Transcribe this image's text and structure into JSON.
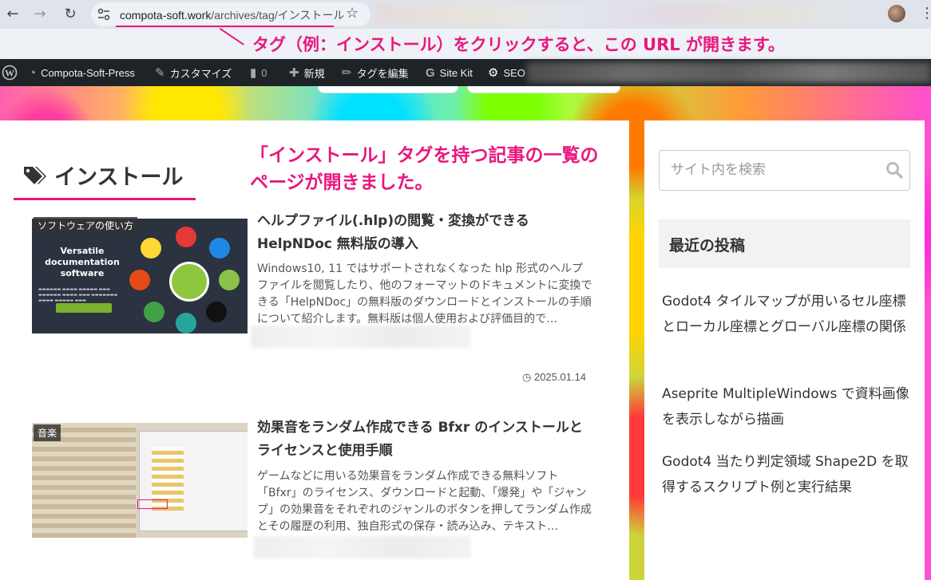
{
  "browser": {
    "url_host": "compota-soft.work",
    "url_path": "/archives/tag/インストール"
  },
  "annotations": {
    "top": "タグ（例：インストール）をクリックすると、この URL が開きます。",
    "middle": "「インストール」タグを持つ記事の一覧のページが開きました。"
  },
  "adminbar": {
    "site": "Compota-Soft-Press",
    "customize": "カスタマイズ",
    "comments_count": "0",
    "new": "新規",
    "edit_tag": "タグを編集",
    "sitekit": "Site Kit",
    "seo": "SEO"
  },
  "tag_page": {
    "title": "インストール"
  },
  "articles": [
    {
      "category": "ソフトウェアの使い方",
      "title": "ヘルプファイル(.hlp)の閲覧・変換ができる HelpNDoc 無料版の導入",
      "snippet": "Windows10, 11 ではサポートされなくなった hlp 形式のヘルプファイルを閲覧したり、他のフォーマットのドキュメントに変換できる「HelpNDoc」の無料版のダウンロードとインストールの手順について紹介します。無料版は個人使用および評価目的で…",
      "date": "2025.01.14",
      "thumb_heading": "Versatile documentation software"
    },
    {
      "category": "音楽",
      "title": "効果音をランダム作成できる Bfxr のインストールとライセンスと使用手順",
      "snippet": "ゲームなどに用いる効果音をランダム作成できる無料ソフト「Bfxr」のライセンス、ダウンロードと起動、「爆発」や「ジャンプ」の効果音をそれぞれのジャンルのボタンを押してランダム作成とその履歴の利用、独自形式の保存・読み込み、テキスト…"
    }
  ],
  "sidebar": {
    "search_placeholder": "サイト内を検索",
    "recent_heading": "最近の投稿",
    "recent_posts": [
      "Godot4 タイルマップが用いるセル座標とローカル座標とグローバル座標の関係",
      "Aseprite MultipleWindows で資料画像を表示しながら描画",
      "Godot4 当たり判定領域 Shape2D を取得するスクリプト例と実行結果"
    ]
  },
  "colors": {
    "accent": "#e8177e",
    "adminbar": "#1d2327"
  }
}
